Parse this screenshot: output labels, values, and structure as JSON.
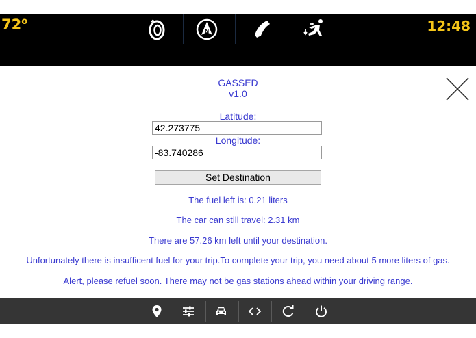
{
  "status_bar": {
    "temperature": "72",
    "temperature_unit": "o",
    "time": "12:48",
    "icons": [
      "audio-icon",
      "navigation-icon",
      "phone-icon",
      "climate-icon"
    ],
    "accent_color": "#f5c518"
  },
  "app": {
    "name": "GASSED",
    "version": "v1.0"
  },
  "form": {
    "latitude_label": "Latitude:",
    "latitude_value": "42.273775",
    "longitude_label": "Longitude:",
    "longitude_value": "-83.740286",
    "set_destination_label": "Set Destination"
  },
  "messages": {
    "fuel_left": "The fuel left is: 0.21 liters",
    "range": "The car can still travel: 2.31 km",
    "distance": "There are 57.26 km left until your destination.",
    "insufficient": "Unfortunately there is insufficent fuel for your trip.To complete your trip, you need about 5 more liters of gas.",
    "alert": "Alert, please refuel soon. There may not be gas stations ahead within your driving range.",
    "text_color": "#3a3ad0"
  },
  "bottom_bar": {
    "icons": [
      "location-pin-icon",
      "settings-sliders-icon",
      "car-icon",
      "code-icon",
      "refresh-icon",
      "power-icon"
    ]
  }
}
